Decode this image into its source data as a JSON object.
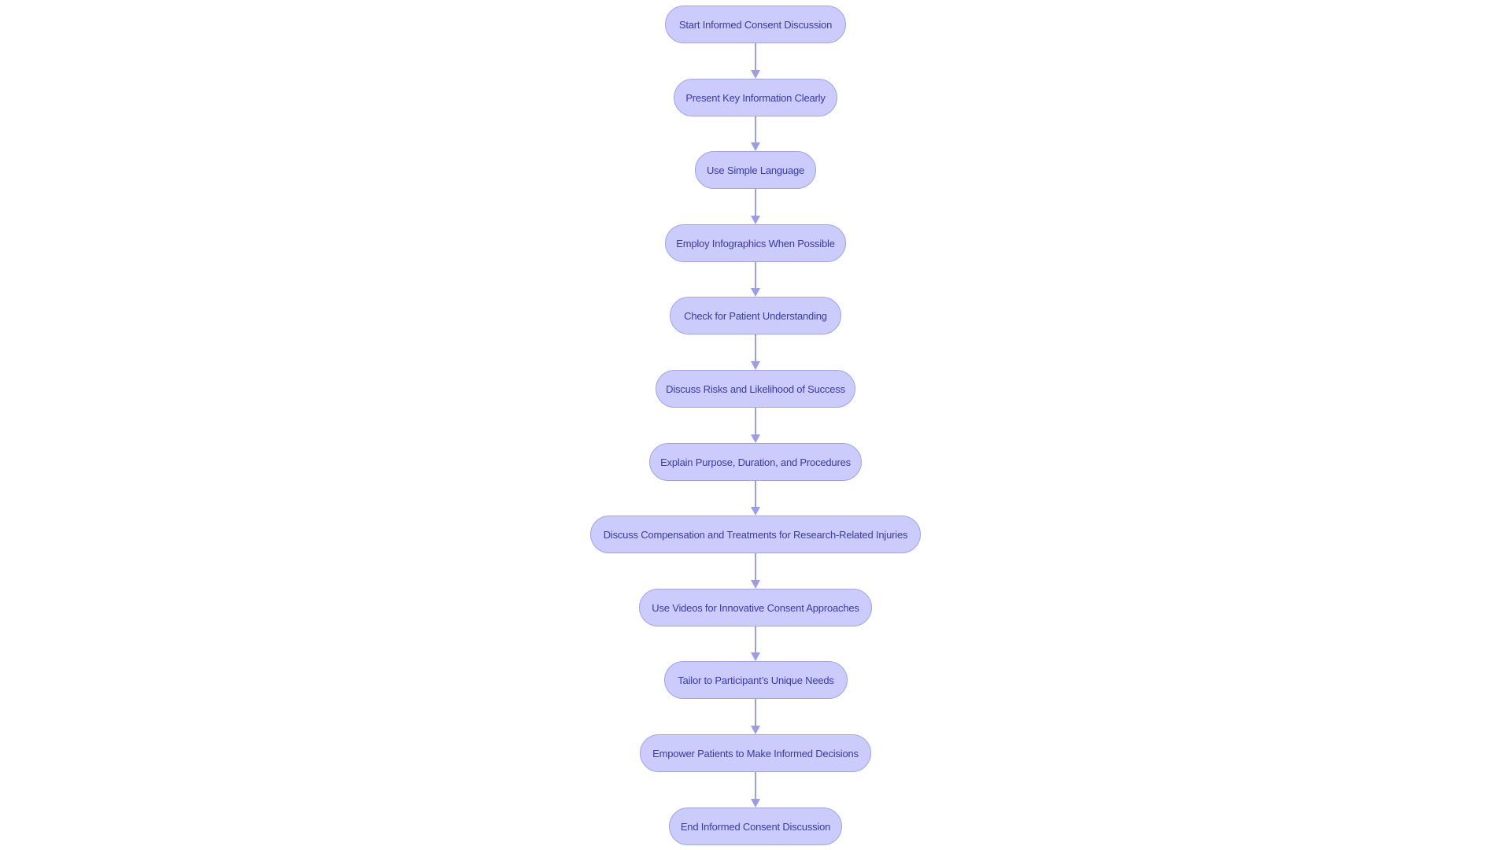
{
  "diagram": {
    "type": "flowchart",
    "direction": "top-to-bottom",
    "colors": {
      "node_fill": "#cbcbfc",
      "node_border": "#a3a3e6",
      "node_text": "#3b3ba3",
      "edge": "#9d9de6"
    },
    "nodes": [
      {
        "id": "n1",
        "label": "Start Informed Consent Discussion"
      },
      {
        "id": "n2",
        "label": "Present Key Information Clearly"
      },
      {
        "id": "n3",
        "label": "Use Simple Language"
      },
      {
        "id": "n4",
        "label": "Employ Infographics When Possible"
      },
      {
        "id": "n5",
        "label": "Check for Patient Understanding"
      },
      {
        "id": "n6",
        "label": "Discuss Risks and Likelihood of Success"
      },
      {
        "id": "n7",
        "label": "Explain Purpose, Duration, and Procedures"
      },
      {
        "id": "n8",
        "label": "Discuss Compensation and Treatments for Research-Related Injuries"
      },
      {
        "id": "n9",
        "label": "Use Videos for Innovative Consent Approaches"
      },
      {
        "id": "n10",
        "label": "Tailor to Participant’s Unique Needs"
      },
      {
        "id": "n11",
        "label": "Empower Patients to Make Informed Decisions"
      },
      {
        "id": "n12",
        "label": "End Informed Consent Discussion"
      }
    ],
    "edges": [
      {
        "from": "n1",
        "to": "n2"
      },
      {
        "from": "n2",
        "to": "n3"
      },
      {
        "from": "n3",
        "to": "n4"
      },
      {
        "from": "n4",
        "to": "n5"
      },
      {
        "from": "n5",
        "to": "n6"
      },
      {
        "from": "n6",
        "to": "n7"
      },
      {
        "from": "n7",
        "to": "n8"
      },
      {
        "from": "n8",
        "to": "n9"
      },
      {
        "from": "n9",
        "to": "n10"
      },
      {
        "from": "n10",
        "to": "n11"
      },
      {
        "from": "n11",
        "to": "n12"
      }
    ]
  }
}
